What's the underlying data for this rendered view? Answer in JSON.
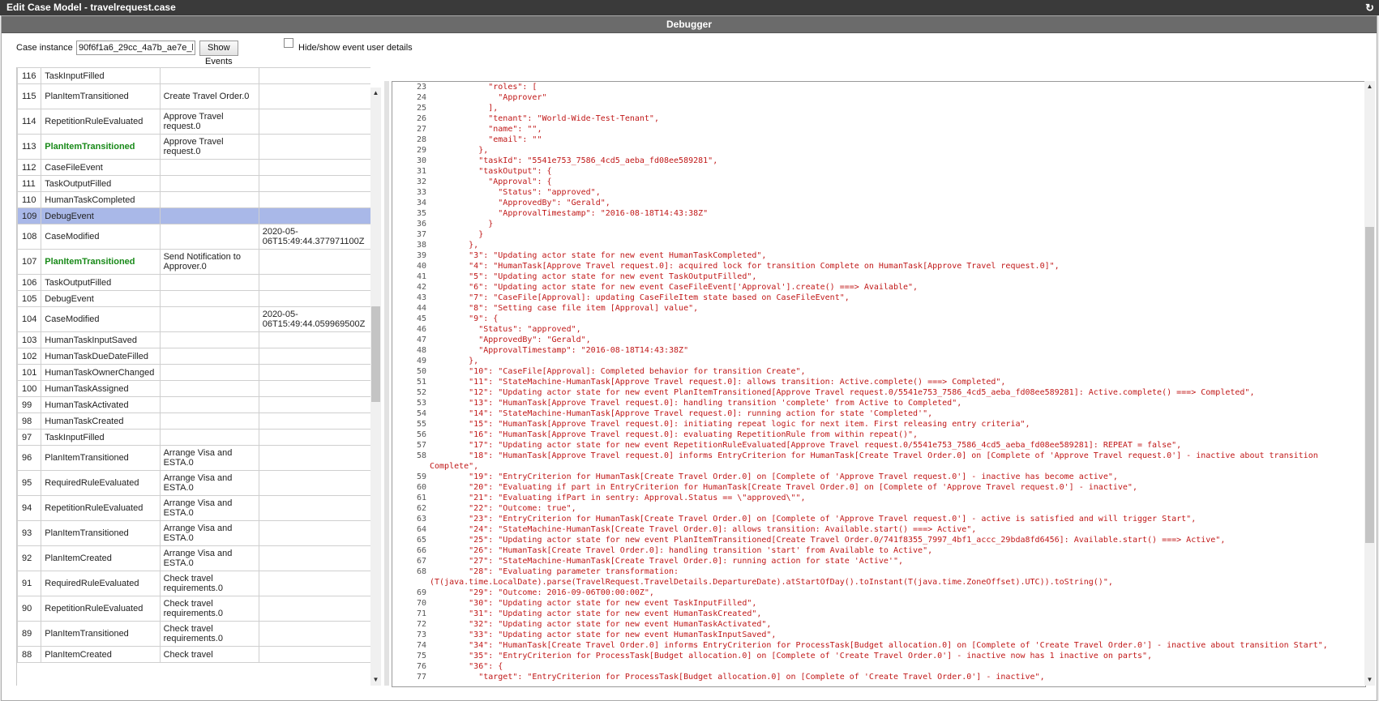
{
  "window": {
    "title": "Edit Case Model - travelrequest.case",
    "refresh_icon": "refresh-icon"
  },
  "panel": {
    "title": "Debugger"
  },
  "toolbar": {
    "case_instance_label": "Case instance",
    "case_instance_value": "90f6f1a6_29cc_4a7b_ae7e_l",
    "show_events_label": "Show Events",
    "hide_show_label": "Hide/show event user details",
    "hide_show_checked": false
  },
  "colors": {
    "selected_row": "#a9b8e8",
    "green_event": "#198a19",
    "code_text": "#c01818",
    "titlebar": "#3a3a3a",
    "panel_header": "#6b6b6b"
  },
  "events": [
    {
      "n": "116",
      "type": "TaskInputFilled",
      "item": "",
      "time": ""
    },
    {
      "n": "115",
      "type": "PlanItemTransitioned",
      "item": "Create Travel Order.0",
      "time": ""
    },
    {
      "n": "114",
      "type": "RepetitionRuleEvaluated",
      "item": "Approve Travel request.0",
      "time": ""
    },
    {
      "n": "113",
      "type": "PlanItemTransitioned",
      "item": "Approve Travel request.0",
      "time": "",
      "highlight": true
    },
    {
      "n": "112",
      "type": "CaseFileEvent",
      "item": "",
      "time": ""
    },
    {
      "n": "111",
      "type": "TaskOutputFilled",
      "item": "",
      "time": ""
    },
    {
      "n": "110",
      "type": "HumanTaskCompleted",
      "item": "",
      "time": ""
    },
    {
      "n": "109",
      "type": "DebugEvent",
      "item": "",
      "time": "",
      "selected": true
    },
    {
      "n": "108",
      "type": "CaseModified",
      "item": "",
      "time": "2020-05-06T15:49:44.377971100Z"
    },
    {
      "n": "107",
      "type": "PlanItemTransitioned",
      "item": "Send Notification to Approver.0",
      "time": "",
      "highlight": true
    },
    {
      "n": "106",
      "type": "TaskOutputFilled",
      "item": "",
      "time": ""
    },
    {
      "n": "105",
      "type": "DebugEvent",
      "item": "",
      "time": ""
    },
    {
      "n": "104",
      "type": "CaseModified",
      "item": "",
      "time": "2020-05-06T15:49:44.059969500Z"
    },
    {
      "n": "103",
      "type": "HumanTaskInputSaved",
      "item": "",
      "time": ""
    },
    {
      "n": "102",
      "type": "HumanTaskDueDateFilled",
      "item": "",
      "time": ""
    },
    {
      "n": "101",
      "type": "HumanTaskOwnerChanged",
      "item": "",
      "time": ""
    },
    {
      "n": "100",
      "type": "HumanTaskAssigned",
      "item": "",
      "time": ""
    },
    {
      "n": "99",
      "type": "HumanTaskActivated",
      "item": "",
      "time": ""
    },
    {
      "n": "98",
      "type": "HumanTaskCreated",
      "item": "",
      "time": ""
    },
    {
      "n": "97",
      "type": "TaskInputFilled",
      "item": "",
      "time": ""
    },
    {
      "n": "96",
      "type": "PlanItemTransitioned",
      "item": "Arrange Visa and ESTA.0",
      "time": ""
    },
    {
      "n": "95",
      "type": "RequiredRuleEvaluated",
      "item": "Arrange Visa and ESTA.0",
      "time": ""
    },
    {
      "n": "94",
      "type": "RepetitionRuleEvaluated",
      "item": "Arrange Visa and ESTA.0",
      "time": ""
    },
    {
      "n": "93",
      "type": "PlanItemTransitioned",
      "item": "Arrange Visa and ESTA.0",
      "time": ""
    },
    {
      "n": "92",
      "type": "PlanItemCreated",
      "item": "Arrange Visa and ESTA.0",
      "time": ""
    },
    {
      "n": "91",
      "type": "RequiredRuleEvaluated",
      "item": "Check travel requirements.0",
      "time": ""
    },
    {
      "n": "90",
      "type": "RepetitionRuleEvaluated",
      "item": "Check travel requirements.0",
      "time": ""
    },
    {
      "n": "89",
      "type": "PlanItemTransitioned",
      "item": "Check travel requirements.0",
      "time": ""
    },
    {
      "n": "88",
      "type": "PlanItemCreated",
      "item": "Check travel",
      "time": ""
    }
  ],
  "code_lines": [
    {
      "n": "23",
      "t": "            \"roles\": ["
    },
    {
      "n": "24",
      "t": "              \"Approver\""
    },
    {
      "n": "25",
      "t": "            ],"
    },
    {
      "n": "26",
      "t": "            \"tenant\": \"World-Wide-Test-Tenant\","
    },
    {
      "n": "27",
      "t": "            \"name\": \"\","
    },
    {
      "n": "28",
      "t": "            \"email\": \"\""
    },
    {
      "n": "29",
      "t": "          },"
    },
    {
      "n": "30",
      "t": "          \"taskId\": \"5541e753_7586_4cd5_aeba_fd08ee589281\","
    },
    {
      "n": "31",
      "t": "          \"taskOutput\": {"
    },
    {
      "n": "32",
      "t": "            \"Approval\": {"
    },
    {
      "n": "33",
      "t": "              \"Status\": \"approved\","
    },
    {
      "n": "34",
      "t": "              \"ApprovedBy\": \"Gerald\","
    },
    {
      "n": "35",
      "t": "              \"ApprovalTimestamp\": \"2016-08-18T14:43:38Z\""
    },
    {
      "n": "36",
      "t": "            }"
    },
    {
      "n": "37",
      "t": "          }"
    },
    {
      "n": "38",
      "t": "        },"
    },
    {
      "n": "39",
      "t": "        \"3\": \"Updating actor state for new event HumanTaskCompleted\","
    },
    {
      "n": "40",
      "t": "        \"4\": \"HumanTask[Approve Travel request.0]: acquired lock for transition Complete on HumanTask[Approve Travel request.0]\","
    },
    {
      "n": "41",
      "t": "        \"5\": \"Updating actor state for new event TaskOutputFilled\","
    },
    {
      "n": "42",
      "t": "        \"6\": \"Updating actor state for new event CaseFileEvent['Approval'].create() ===> Available\","
    },
    {
      "n": "43",
      "t": "        \"7\": \"CaseFile[Approval]: updating CaseFileItem state based on CaseFileEvent\","
    },
    {
      "n": "44",
      "t": "        \"8\": \"Setting case file item [Approval] value\","
    },
    {
      "n": "45",
      "t": "        \"9\": {"
    },
    {
      "n": "46",
      "t": "          \"Status\": \"approved\","
    },
    {
      "n": "47",
      "t": "          \"ApprovedBy\": \"Gerald\","
    },
    {
      "n": "48",
      "t": "          \"ApprovalTimestamp\": \"2016-08-18T14:43:38Z\""
    },
    {
      "n": "49",
      "t": "        },"
    },
    {
      "n": "50",
      "t": "        \"10\": \"CaseFile[Approval]: Completed behavior for transition Create\","
    },
    {
      "n": "51",
      "t": "        \"11\": \"StateMachine-HumanTask[Approve Travel request.0]: allows transition: Active.complete() ===> Completed\","
    },
    {
      "n": "52",
      "t": "        \"12\": \"Updating actor state for new event PlanItemTransitioned[Approve Travel request.0/5541e753_7586_4cd5_aeba_fd08ee589281]: Active.complete() ===> Completed\","
    },
    {
      "n": "53",
      "t": "        \"13\": \"HumanTask[Approve Travel request.0]: handling transition 'complete' from Active to Completed\","
    },
    {
      "n": "54",
      "t": "        \"14\": \"StateMachine-HumanTask[Approve Travel request.0]: running action for state 'Completed'\","
    },
    {
      "n": "55",
      "t": "        \"15\": \"HumanTask[Approve Travel request.0]: initiating repeat logic for next item. First releasing entry criteria\","
    },
    {
      "n": "56",
      "t": "        \"16\": \"HumanTask[Approve Travel request.0]: evaluating RepetitionRule from within repeat()\","
    },
    {
      "n": "57",
      "t": "        \"17\": \"Updating actor state for new event RepetitionRuleEvaluated[Approve Travel request.0/5541e753_7586_4cd5_aeba_fd08ee589281]: REPEAT = false\","
    },
    {
      "n": "58",
      "t": "        \"18\": \"HumanTask[Approve Travel request.0] informs EntryCriterion for HumanTask[Create Travel Order.0] on [Complete of 'Approve Travel request.0'] - inactive about transition"
    },
    {
      "n": "",
      "t": "Complete\","
    },
    {
      "n": "59",
      "t": "        \"19\": \"EntryCriterion for HumanTask[Create Travel Order.0] on [Complete of 'Approve Travel request.0'] - inactive has become active\","
    },
    {
      "n": "60",
      "t": "        \"20\": \"Evaluating if part in EntryCriterion for HumanTask[Create Travel Order.0] on [Complete of 'Approve Travel request.0'] - inactive\","
    },
    {
      "n": "61",
      "t": "        \"21\": \"Evaluating ifPart in sentry: Approval.Status == \\\"approved\\\"\","
    },
    {
      "n": "62",
      "t": "        \"22\": \"Outcome: true\","
    },
    {
      "n": "63",
      "t": "        \"23\": \"EntryCriterion for HumanTask[Create Travel Order.0] on [Complete of 'Approve Travel request.0'] - active is satisfied and will trigger Start\","
    },
    {
      "n": "64",
      "t": "        \"24\": \"StateMachine-HumanTask[Create Travel Order.0]: allows transition: Available.start() ===> Active\","
    },
    {
      "n": "65",
      "t": "        \"25\": \"Updating actor state for new event PlanItemTransitioned[Create Travel Order.0/741f8355_7997_4bf1_accc_29bda8fd6456]: Available.start() ===> Active\","
    },
    {
      "n": "66",
      "t": "        \"26\": \"HumanTask[Create Travel Order.0]: handling transition 'start' from Available to Active\","
    },
    {
      "n": "67",
      "t": "        \"27\": \"StateMachine-HumanTask[Create Travel Order.0]: running action for state 'Active'\","
    },
    {
      "n": "68",
      "t": "        \"28\": \"Evaluating parameter transformation:"
    },
    {
      "n": "",
      "t": "(T(java.time.LocalDate).parse(TravelRequest.TravelDetails.DepartureDate).atStartOfDay().toInstant(T(java.time.ZoneOffset).UTC)).toString()\","
    },
    {
      "n": "69",
      "t": "        \"29\": \"Outcome: 2016-09-06T00:00:00Z\","
    },
    {
      "n": "70",
      "t": "        \"30\": \"Updating actor state for new event TaskInputFilled\","
    },
    {
      "n": "71",
      "t": "        \"31\": \"Updating actor state for new event HumanTaskCreated\","
    },
    {
      "n": "72",
      "t": "        \"32\": \"Updating actor state for new event HumanTaskActivated\","
    },
    {
      "n": "73",
      "t": "        \"33\": \"Updating actor state for new event HumanTaskInputSaved\","
    },
    {
      "n": "74",
      "t": "        \"34\": \"HumanTask[Create Travel Order.0] informs EntryCriterion for ProcessTask[Budget allocation.0] on [Complete of 'Create Travel Order.0'] - inactive about transition Start\","
    },
    {
      "n": "75",
      "t": "        \"35\": \"EntryCriterion for ProcessTask[Budget allocation.0] on [Complete of 'Create Travel Order.0'] - inactive now has 1 inactive on parts\","
    },
    {
      "n": "76",
      "t": "        \"36\": {"
    },
    {
      "n": "77",
      "t": "          \"target\": \"EntryCriterion for ProcessTask[Budget allocation.0] on [Complete of 'Create Travel Order.0'] - inactive\","
    }
  ]
}
